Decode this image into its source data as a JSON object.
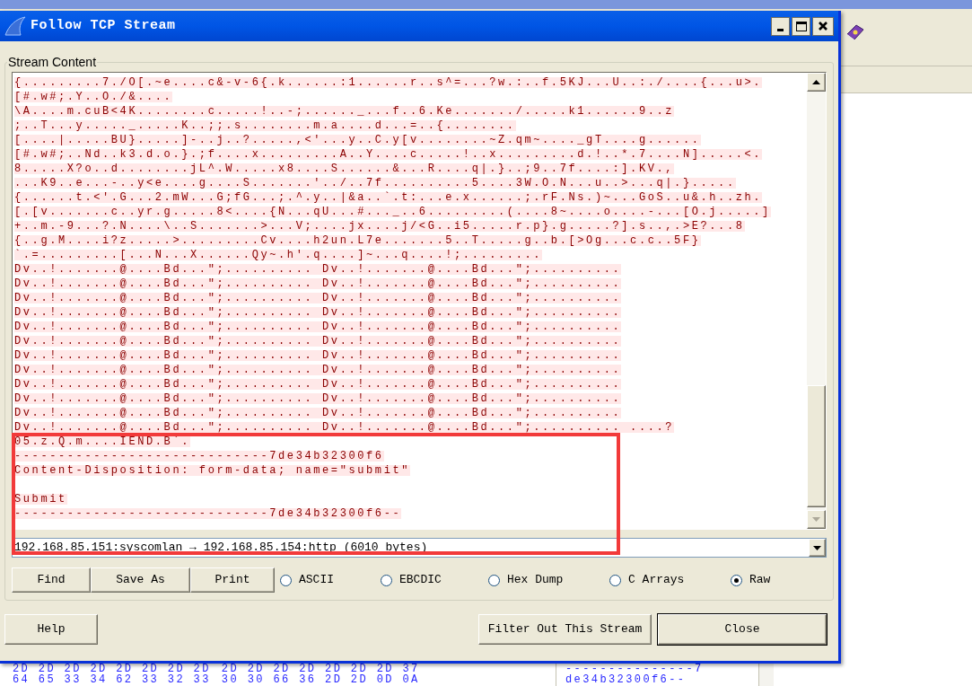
{
  "window": {
    "title": "Follow TCP Stream"
  },
  "stream_content": {
    "label": "Stream Content",
    "lines": [
      {
        "kind": "text",
        "text": "{.........7./O[.~e....c&-v-6{.k......:1......r..s^=...?w.:..f.5KJ...U..:./....{...u>."
      },
      {
        "kind": "text",
        "text": "[#.w#;.Y..O./&...."
      },
      {
        "kind": "text",
        "text": "\\A....m.cuB<4K........c.....!..-;......_...f..6.Ke......./.....k1......9..z"
      },
      {
        "kind": "text",
        "text": ";..T...y....._.....K..;;.s........m.a....d...=..{........"
      },
      {
        "kind": "text",
        "text": "[....|.....BU}.....]-..j..?.....,<'...y..C.y[v........~Z.qm~...._gT....g......"
      },
      {
        "kind": "text",
        "text": "[#.w#;..Nd..k3.d.o.}.;f....x.........A..Y....c.....!..x.........d.!..*.7....N].....<."
      },
      {
        "kind": "text",
        "text": "8.....X?o..d........jL^.W.....x8....S......&...R....q|.}..;9..7f....:].KV.,"
      },
      {
        "kind": "text",
        "text": "...K9..e...-..y<e....g....S.......'../..7f..........5....3W.O.N...u..>...q|.}....."
      },
      {
        "kind": "text",
        "text": "{......t.<'.G...2.mW...G;fG...;.^.y..|&a..`.t:...e.x......;.rF.Ns.)~...GoS..u&.h..zh."
      },
      {
        "kind": "text",
        "text": "[.[v.......c..yr.g.....8<....{N...qU...#..._..6.........(....8~....o....-...[O.j.....]"
      },
      {
        "kind": "text",
        "text": "+..m.-9...?.N....\\..S.......>...V;....jx....j/<G..i5.....r.p}.g.....?].s..,.>E?...8"
      },
      {
        "kind": "text",
        "text": "{..g.M....i?z.....>.........Cv....h2un.L7e.......5..T.....g..b.[>Og...c.c..5F}"
      },
      {
        "kind": "text",
        "text": "`.=.........[...N...X......Qy~.h'.q....]~...q....!;........."
      },
      {
        "kind": "text",
        "text": "Dv..!.......@....Bd...\";.......... Dv..!.......@....Bd...\";.........."
      },
      {
        "kind": "text",
        "text": "Dv..!.......@....Bd...\";.......... Dv..!.......@....Bd...\";.........."
      },
      {
        "kind": "text",
        "text": "Dv..!.......@....Bd...\";.......... Dv..!.......@....Bd...\";.........."
      },
      {
        "kind": "text",
        "text": "Dv..!.......@....Bd...\";.......... Dv..!.......@....Bd...\";.........."
      },
      {
        "kind": "text",
        "text": "Dv..!.......@....Bd...\";.......... Dv..!.......@....Bd...\";.........."
      },
      {
        "kind": "text",
        "text": "Dv..!.......@....Bd...\";.......... Dv..!.......@....Bd...\";.........."
      },
      {
        "kind": "text",
        "text": "Dv..!.......@....Bd...\";.......... Dv..!.......@....Bd...\";.........."
      },
      {
        "kind": "text",
        "text": "Dv..!.......@....Bd...\";.......... Dv..!.......@....Bd...\";.........."
      },
      {
        "kind": "text",
        "text": "Dv..!.......@....Bd...\";.......... Dv..!.......@....Bd...\";.........."
      },
      {
        "kind": "text",
        "text": "Dv..!.......@....Bd...\";.......... Dv..!.......@....Bd...\";.........."
      },
      {
        "kind": "text",
        "text": "Dv..!.......@....Bd...\";.......... Dv..!.......@....Bd...\";.........."
      },
      {
        "kind": "text",
        "text": "Dv..!.......@....Bd...\";.......... Dv..!.......@....Bd...\";.......... ....?"
      },
      {
        "kind": "text",
        "text": "05.z.Q.m....IEND.B`."
      },
      {
        "kind": "text",
        "text": "-----------------------------7de34b32300f6"
      },
      {
        "kind": "text",
        "text": "Content-Disposition: form-data; name=\"submit\""
      },
      {
        "kind": "blank"
      },
      {
        "kind": "text",
        "text": "Submit"
      },
      {
        "kind": "text",
        "text": "-----------------------------7de34b32300f6--"
      }
    ]
  },
  "conversation": {
    "value": "192.168.85.151:syscomlan → 192.168.85.154:http (6010 bytes)"
  },
  "actions": [
    "Find",
    "Save As",
    "Print"
  ],
  "formats": [
    {
      "label": "ASCII",
      "selected": false
    },
    {
      "label": "EBCDIC",
      "selected": false
    },
    {
      "label": "Hex Dump",
      "selected": false
    },
    {
      "label": "C Arrays",
      "selected": false
    },
    {
      "label": "Raw",
      "selected": true
    }
  ],
  "dialog_buttons": [
    {
      "label": "Help",
      "default": false
    },
    {
      "label": "Filter Out This Stream",
      "default": false
    },
    {
      "label": "Close",
      "default": true
    }
  ],
  "background_hex": {
    "rows": [
      {
        "bytes_1": "2D 2D 2D 2D 2D 2D 2D 2D",
        "bytes_2": "2D 2D 2D 2D 2D 2D 2D 37",
        "ascii": "---------------7"
      },
      {
        "bytes_1": "64 65 33 34 62 33 32 33",
        "bytes_2": "30 30 66 36 2D 2D 0D 0A",
        "ascii": "de34b32300f6--"
      }
    ]
  }
}
